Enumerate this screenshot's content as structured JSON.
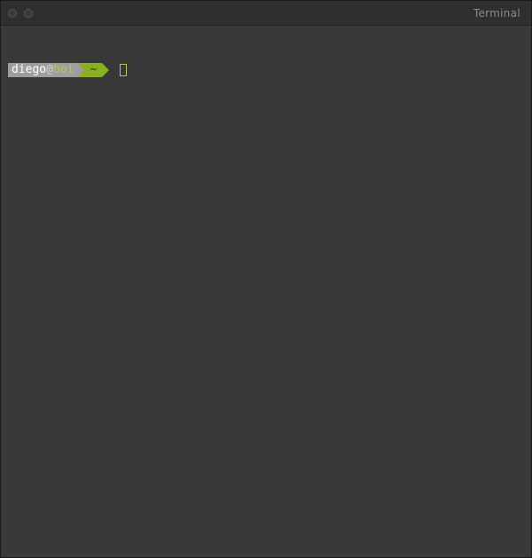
{
  "window": {
    "title": "Terminal"
  },
  "prompt": {
    "user": "diego",
    "at": "@",
    "host": "boi",
    "dir": "~"
  }
}
